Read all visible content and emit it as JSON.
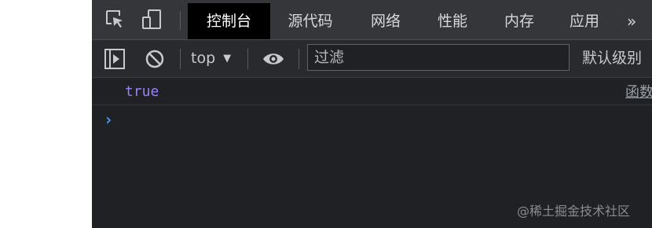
{
  "tabs": [
    "控制台",
    "源代码",
    "网络",
    "性能",
    "内存",
    "应用"
  ],
  "active_tab": "控制台",
  "more_label": "»",
  "toolbar": {
    "context": "top",
    "context_caret": "▼",
    "filter_placeholder": "过滤",
    "level_label": "默认级别"
  },
  "console": {
    "log_value": "true",
    "source_link": "函数",
    "prompt": "›"
  },
  "watermark": "@稀土掘金技术社区",
  "colors": {
    "panel_bg": "#202124",
    "tabbar_bg": "#35363a",
    "active_tab_bg": "#000000",
    "boolean_value": "#9980ff",
    "prompt": "#4d9df6"
  }
}
